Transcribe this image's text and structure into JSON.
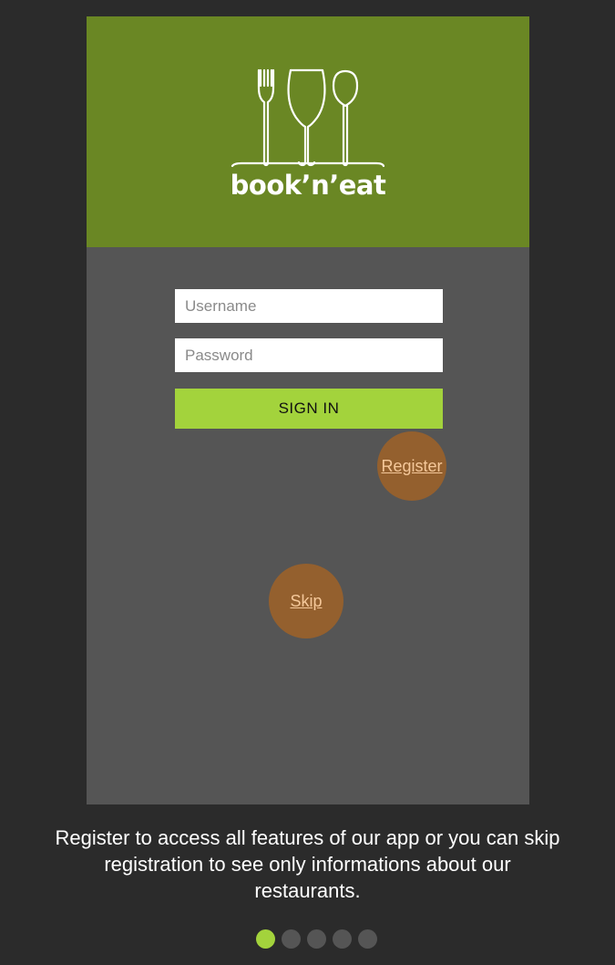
{
  "app": {
    "logo_text": "book’n’eat"
  },
  "login": {
    "username_placeholder": "Username",
    "password_placeholder": "Password",
    "signin_label": "SIGN IN",
    "register_label": "Register",
    "skip_label": "Skip"
  },
  "caption": {
    "text": "Register to access all features of our app or you can skip registration to see only informations about our restaurants."
  },
  "pagination": {
    "total": 5,
    "active_index": 0
  },
  "colors": {
    "background": "#2b2b2b",
    "header_green": "#6a8724",
    "panel_gray": "#555555",
    "accent_lime": "#a3d33c",
    "bubble_brown": "#94602e",
    "bubble_text": "#f5c89a"
  }
}
